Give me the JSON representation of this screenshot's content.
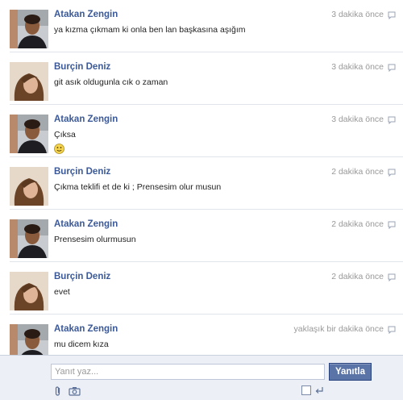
{
  "messages": [
    {
      "sender": "Atakan Zengin",
      "text": "ya kızma çıkmam ki onla ben lan başkasına aşığım",
      "time": "3 dakika önce",
      "avatar": "male"
    },
    {
      "sender": "Burçin Deniz",
      "text": "git asık oldugunla cık o zaman",
      "time": "3 dakika önce",
      "avatar": "female"
    },
    {
      "sender": "Atakan Zengin",
      "text": "Çıksa",
      "time": "3 dakika önce",
      "avatar": "male",
      "emoji": "smiley-icon"
    },
    {
      "sender": "Burçin Deniz",
      "text": "Çıkma teklifi et de ki ; Prensesim olur musun",
      "time": "2 dakika önce",
      "avatar": "female"
    },
    {
      "sender": "Atakan Zengin",
      "text": "Prensesim olurmusun",
      "time": "2 dakika önce",
      "avatar": "male"
    },
    {
      "sender": "Burçin Deniz",
      "text": "evet",
      "time": "2 dakika önce",
      "avatar": "female"
    },
    {
      "sender": "Atakan Zengin",
      "text": "mu dicem kıza",
      "time": "yaklaşık bir dakika önce",
      "avatar": "male"
    }
  ],
  "composer": {
    "placeholder": "Yanıt yaz...",
    "send_label": "Yanıtla",
    "icons": [
      "attach-icon",
      "camera-icon",
      "enter-icon"
    ]
  },
  "colors": {
    "sender": "#3b5998",
    "time": "#999999",
    "button": "#5b74a8",
    "composer_bg": "#eceff5"
  }
}
